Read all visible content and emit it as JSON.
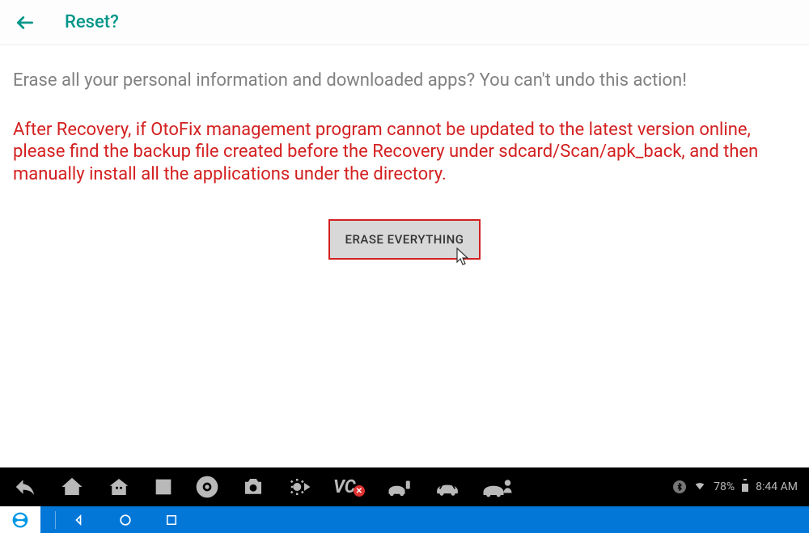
{
  "header": {
    "title": "Reset?"
  },
  "content": {
    "prompt": "Erase all your personal information and downloaded apps? You can't undo this action!",
    "warning": "After Recovery, if OtoFix management program cannot be updated to the latest version online, please find the backup file created before the Recovery under sdcard/Scan/apk_back, and then manually install all the applications under the directory.",
    "erase_button": "ERASE EVERYTHING"
  },
  "statusbar": {
    "vc_label": "VC",
    "battery_percent": "78%",
    "time": "8:44 AM"
  }
}
